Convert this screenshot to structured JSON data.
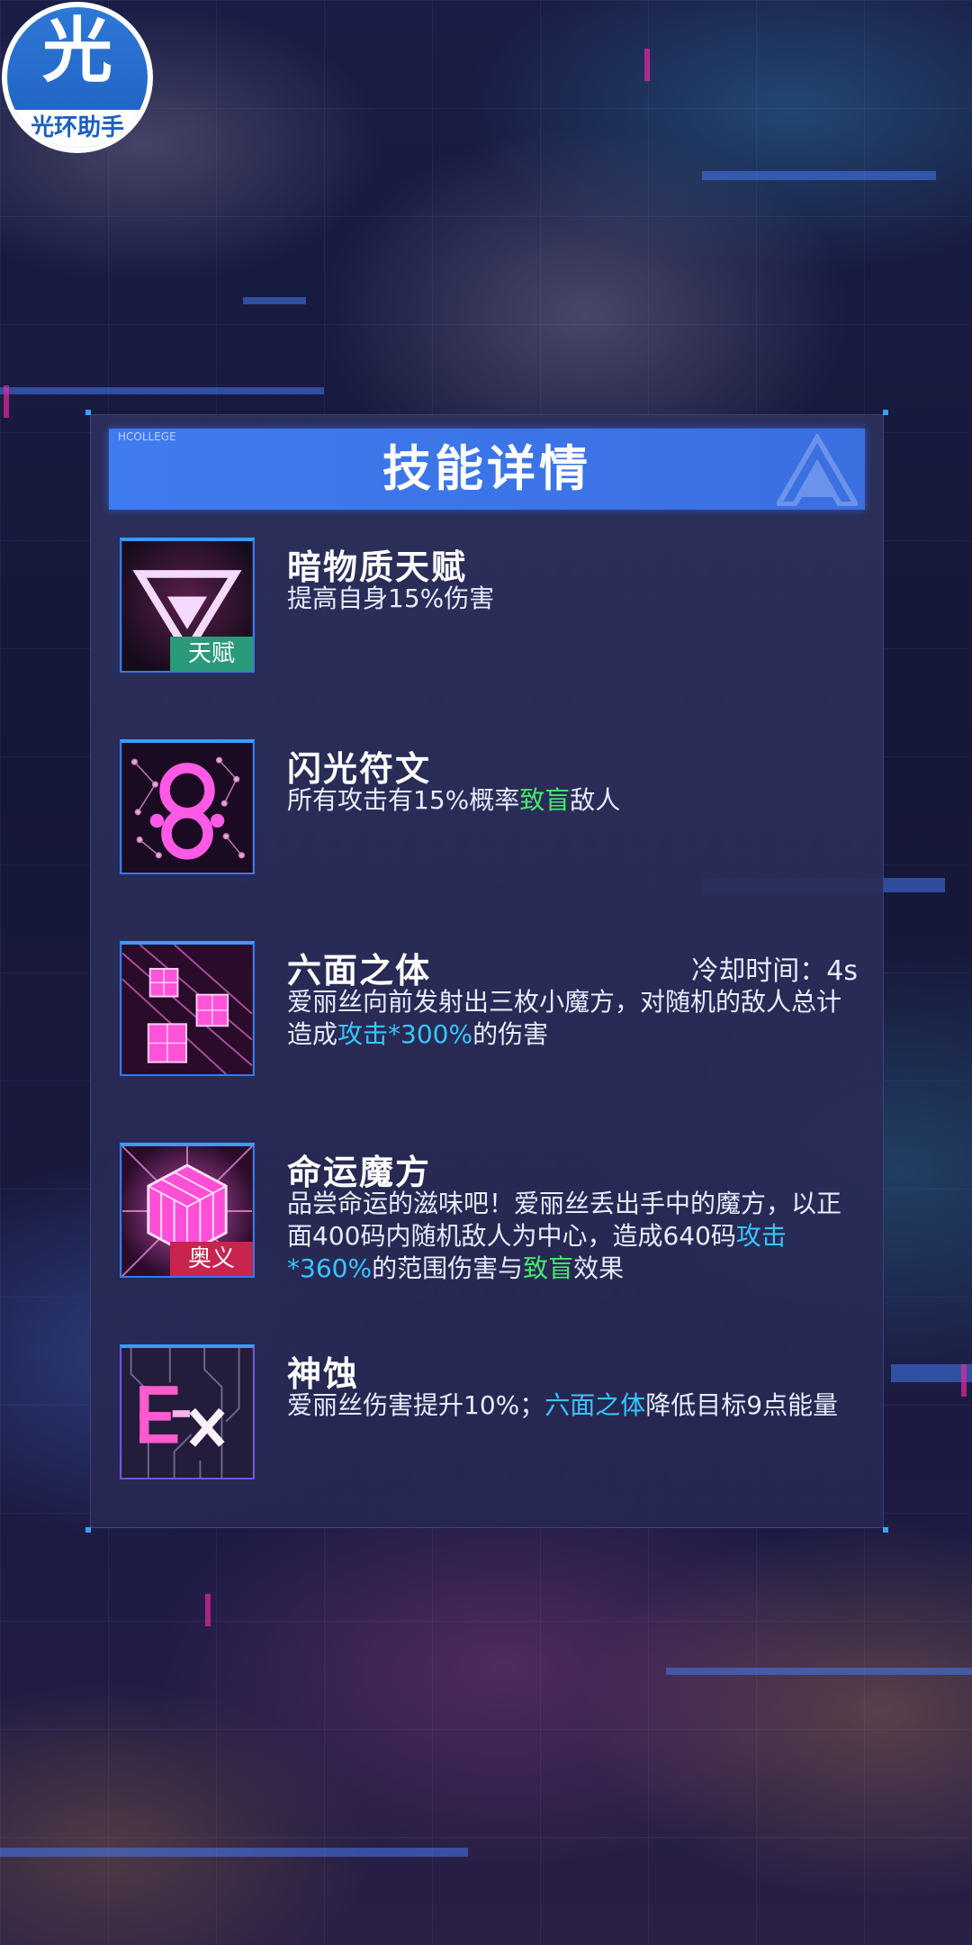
{
  "app": {
    "logo_char": "光",
    "logo_text": "光环助手"
  },
  "panel": {
    "title": "技能详情",
    "title_tag": "HCOLLEGE"
  },
  "skills": [
    {
      "name": "暗物质天赋",
      "badge": "天赋",
      "icon": "dark-matter-triangle-icon",
      "desc": {
        "t1": "提高自身15%伤害"
      }
    },
    {
      "name": "闪光符文",
      "icon": "flash-rune-icon",
      "desc": {
        "t1": "所有攻击有15%概率",
        "h1": "致盲",
        "t2": "敌人"
      }
    },
    {
      "name": "六面之体",
      "cooldown": "冷却时间：4s",
      "icon": "cube-barrage-icon",
      "desc": {
        "t1": "爱丽丝向前发射出三枚小魔方，对随机的敌人总计造成",
        "h1": "攻击*300%",
        "t2": "的伤害"
      }
    },
    {
      "name": "命运魔方",
      "badge": "奥义",
      "icon": "fate-cube-icon",
      "desc": {
        "t1": "品尝命运的滋味吧！爱丽丝丢出手中的魔方，以正面400码内随机敌人为中心，造成640码",
        "h1": "攻击*360%",
        "t2": "的范围伤害与",
        "h2": "致盲",
        "t3": "效果"
      }
    },
    {
      "name": "神蚀",
      "icon": "ex-circuit-icon",
      "desc": {
        "t1": "爱丽丝伤害提升10%；",
        "h1": "六面之体",
        "t2": "降低目标9点能量"
      }
    }
  ],
  "colors": {
    "accent_blue": "#3f7bf0",
    "highlight_green": "#48e86c",
    "highlight_cyan": "#36c6ff",
    "badge_green": "#2a9a7a",
    "badge_red": "#c8244e"
  }
}
